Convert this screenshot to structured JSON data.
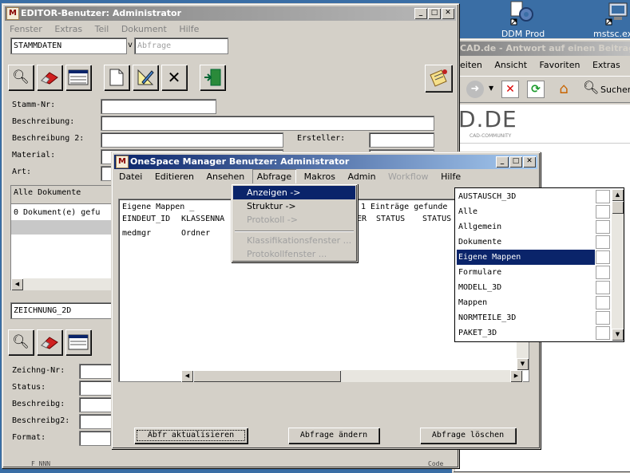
{
  "desktop": {
    "icons": [
      {
        "label": "DDM Prod",
        "icon": "gear-shortcut-icon"
      },
      {
        "label": "mstsc.ex",
        "icon": "remote-desktop-icon"
      }
    ]
  },
  "browser": {
    "title": "CAD.de - Antwort auf einen Beitrag - M",
    "menu": [
      "eiten",
      "Ansicht",
      "Favoriten",
      "Extras",
      "?"
    ],
    "search_label": "Sucher",
    "logo_text": "D.DE",
    "logo_sub": "CAD-COMMUNITY"
  },
  "editor": {
    "title": "EDITOR-Benutzer: Administrator",
    "icon_letter": "M",
    "menu": [
      "Fenster",
      "Extras",
      "Teil",
      "Dokument",
      "Hilfe"
    ],
    "stamm_combo_value": "STAMMDATEN",
    "combo_arrow": "v",
    "abfrage_placeholder": "Abfrage",
    "fields": {
      "stamm_nr": "Stamm-Nr:",
      "beschreibung": "Beschreibung:",
      "beschreibung2": "Beschreibung 2:",
      "ersteller": "Ersteller:",
      "material": "Material:",
      "art": "Art:"
    },
    "docs_header": "Alle Dokumente",
    "docs_count": "0 Dokument(e) gefu",
    "zeichnung_combo_value": "ZEICHNUNG_2D",
    "fields2": {
      "zeichng_nr": "Zeichng-Nr:",
      "status": "Status:",
      "beschreibg": "Beschreibg:",
      "beschreibg2": "Beschreibg2:",
      "format": "Format:"
    },
    "bottom_fragment": "F_NNN",
    "bottom_fragment2": "Code"
  },
  "osm": {
    "title": "OneSpace Manager Benutzer: Administrator",
    "icon_letter": "M",
    "menu": [
      "Datei",
      "Editieren",
      "Ansehen",
      "Abfrage",
      "Makros",
      "Admin",
      "Workflow",
      "Hilfe"
    ],
    "table_title": "Eigene Mappen _",
    "entries_found": "1 Einträge gefunde",
    "columns": [
      "EINDEUT_ID",
      "KLASSENNA",
      "ER",
      "STATUS",
      "STATUS"
    ],
    "rows": [
      [
        "medmgr",
        "Ordner"
      ]
    ],
    "buttons": {
      "refresh": "Abfr aktualisieren",
      "change": "Abfrage ändern",
      "delete": "Abfrage löschen"
    }
  },
  "abfrage_menu": {
    "items": [
      "Anzeigen ->",
      "Struktur ->",
      "Protokoll ->",
      "Klassifikationsfenster ...",
      "Protokollfenster ..."
    ]
  },
  "query_list": {
    "items": [
      "AUSTAUSCH_3D",
      "Alle",
      "Allgemein",
      "Dokumente",
      "Eigene Mappen",
      "Formulare",
      "MODELL_3D",
      "Mappen",
      "NORMTEILE_3D",
      "PAKET_3D"
    ],
    "selected": "Eigene Mappen"
  },
  "colors": {
    "selection": "#0a246a",
    "window_face": "#d4d0c8",
    "desktop": "#3a6ea5"
  }
}
